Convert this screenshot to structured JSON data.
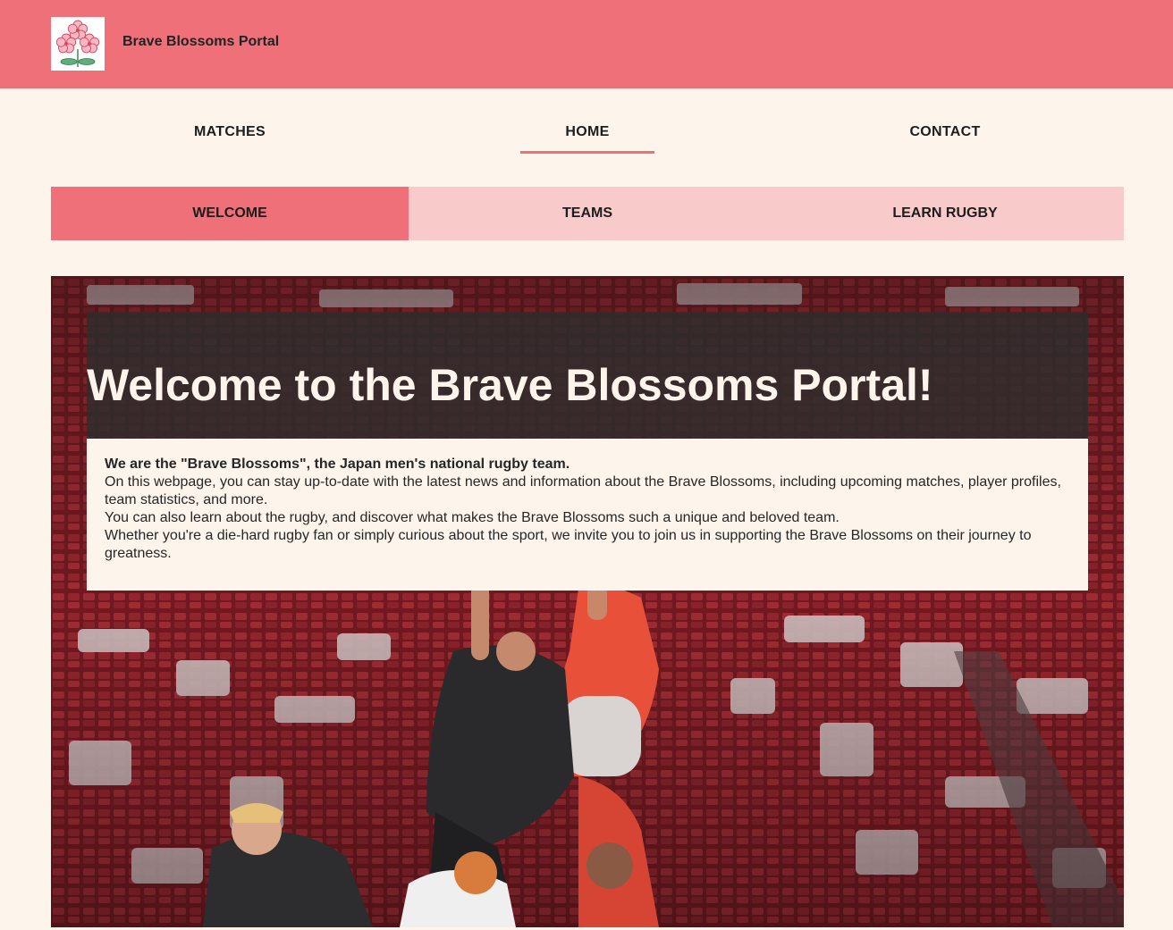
{
  "header": {
    "brand": "Brave Blossoms Portal",
    "logo_icon": "cherry-blossom-logo-icon",
    "bg_color": "#f0707a"
  },
  "nav": {
    "items": [
      {
        "label": "MATCHES",
        "active": false
      },
      {
        "label": "HOME",
        "active": true
      },
      {
        "label": "CONTACT",
        "active": false
      }
    ]
  },
  "subnav": {
    "tabs": [
      {
        "label": "WELCOME",
        "active": true
      },
      {
        "label": "TEAMS",
        "active": false
      },
      {
        "label": "LEARN RUGBY",
        "active": false
      }
    ]
  },
  "hero": {
    "title": "Welcome to the Brave Blossoms Portal!",
    "image": "rugby-lineout-photo",
    "body": {
      "lead": "We are the \"Brave Blossoms\", the Japan men's national rugby team.",
      "lines": [
        "On this webpage, you can stay up-to-date with the latest news and information about the Brave Blossoms, including upcoming matches, player profiles, team statistics, and more.",
        "You can also learn about the rugby, and discover what makes the Brave Blossoms such a unique and beloved team.",
        "Whether you're a die-hard rugby fan or simply curious about the sport, we invite you to join us in supporting the Brave Blossoms on their journey to greatness."
      ]
    }
  },
  "colors": {
    "accent": "#f0707a",
    "tab_bg": "#f8caca",
    "page_bg": "#fdf5ec"
  }
}
